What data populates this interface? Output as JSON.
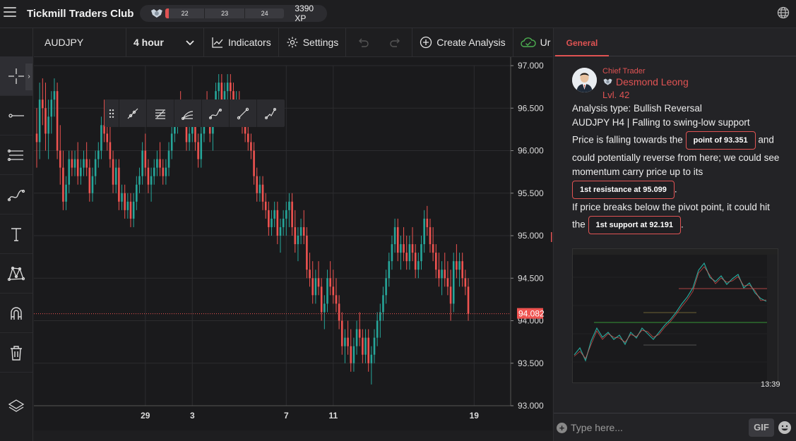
{
  "app": {
    "title": "Tickmill Traders Club"
  },
  "xp": {
    "levels": [
      "22",
      "23",
      "24"
    ],
    "progress_fraction": 0.03,
    "total": "3390 XP"
  },
  "toolbar": {
    "symbol": "AUDJPY",
    "interval": "4 hour",
    "indicators": "Indicators",
    "settings": "Settings",
    "create_analysis": "Create Analysis",
    "cut_label": "Ur"
  },
  "colors": {
    "up": "#26a69a",
    "down": "#ef5350",
    "accent": "#e05353",
    "bg": "#1a1a1c"
  },
  "chart_data": {
    "type": "candlestick",
    "symbol": "AUDJPY",
    "timeframe": "4 hour",
    "ylim": [
      93.0,
      97.0
    ],
    "y_ticks": [
      "97.000",
      "96.500",
      "96.000",
      "95.500",
      "95.000",
      "94.500",
      "94.000",
      "93.500",
      "93.000"
    ],
    "x_ticks": [
      {
        "label": "29",
        "index": 37
      },
      {
        "label": "3",
        "index": 53
      },
      {
        "label": "7",
        "index": 85
      },
      {
        "label": "11",
        "index": 101
      },
      {
        "label": "19",
        "index": 149
      }
    ],
    "last_price": "94.082",
    "ohlc": [
      [
        96.2,
        96.5,
        95.8,
        96.1
      ],
      [
        96.1,
        96.8,
        95.9,
        96.6
      ],
      [
        96.6,
        96.85,
        96.3,
        96.5
      ],
      [
        96.5,
        96.8,
        96.0,
        96.2
      ],
      [
        96.2,
        96.6,
        95.9,
        96.4
      ],
      [
        96.4,
        96.7,
        96.2,
        96.6
      ],
      [
        96.6,
        96.85,
        96.4,
        96.7
      ],
      [
        96.7,
        96.8,
        95.9,
        96.0
      ],
      [
        96.0,
        96.3,
        95.6,
        95.8
      ],
      [
        95.8,
        96.0,
        95.3,
        95.4
      ],
      [
        95.4,
        95.7,
        95.3,
        95.6
      ],
      [
        95.6,
        96.0,
        95.5,
        95.9
      ],
      [
        95.9,
        96.0,
        95.7,
        95.8
      ],
      [
        95.8,
        96.0,
        95.7,
        95.9
      ],
      [
        95.9,
        96.1,
        95.6,
        95.7
      ],
      [
        95.7,
        95.9,
        95.6,
        95.8
      ],
      [
        95.8,
        96.0,
        95.7,
        95.9
      ],
      [
        95.9,
        96.1,
        95.7,
        95.8
      ],
      [
        95.8,
        95.9,
        95.4,
        95.5
      ],
      [
        95.5,
        95.8,
        95.4,
        95.7
      ],
      [
        95.7,
        96.0,
        95.6,
        95.9
      ],
      [
        95.9,
        96.1,
        95.8,
        96.0
      ],
      [
        96.0,
        96.4,
        95.9,
        96.3
      ],
      [
        96.3,
        96.6,
        96.1,
        96.2
      ],
      [
        96.2,
        96.4,
        96.0,
        96.1
      ],
      [
        96.1,
        96.3,
        95.8,
        95.9
      ],
      [
        95.9,
        96.0,
        95.5,
        95.6
      ],
      [
        95.6,
        95.9,
        95.5,
        95.8
      ],
      [
        95.8,
        95.9,
        95.3,
        95.4
      ],
      [
        95.4,
        95.6,
        95.3,
        95.5
      ],
      [
        95.5,
        95.6,
        95.2,
        95.3
      ],
      [
        95.3,
        95.5,
        95.2,
        95.4
      ],
      [
        95.4,
        95.5,
        95.1,
        95.2
      ],
      [
        95.2,
        95.5,
        95.1,
        95.4
      ],
      [
        95.4,
        95.7,
        95.3,
        95.6
      ],
      [
        95.6,
        95.8,
        95.5,
        95.7
      ],
      [
        95.7,
        96.1,
        95.6,
        96.0
      ],
      [
        96.0,
        96.2,
        95.7,
        95.8
      ],
      [
        95.8,
        95.9,
        95.5,
        95.6
      ],
      [
        95.6,
        95.8,
        95.4,
        95.7
      ],
      [
        95.7,
        95.9,
        95.6,
        95.8
      ],
      [
        95.8,
        96.0,
        95.7,
        95.9
      ],
      [
        95.9,
        96.1,
        95.7,
        95.8
      ],
      [
        95.8,
        95.9,
        95.6,
        95.7
      ],
      [
        95.7,
        95.9,
        95.6,
        95.8
      ],
      [
        95.8,
        96.1,
        95.7,
        96.0
      ],
      [
        96.0,
        96.3,
        95.9,
        96.2
      ],
      [
        96.2,
        96.5,
        96.1,
        96.4
      ],
      [
        96.4,
        96.6,
        96.2,
        96.5
      ],
      [
        96.5,
        96.7,
        96.3,
        96.4
      ],
      [
        96.4,
        96.6,
        96.3,
        96.5
      ],
      [
        96.5,
        96.6,
        96.0,
        96.1
      ],
      [
        96.1,
        96.3,
        96.0,
        96.2
      ],
      [
        96.2,
        96.4,
        96.1,
        96.3
      ],
      [
        96.3,
        96.5,
        96.0,
        96.1
      ],
      [
        96.1,
        96.2,
        95.8,
        95.9
      ],
      [
        95.9,
        96.3,
        95.8,
        96.2
      ],
      [
        96.2,
        96.6,
        96.1,
        96.5
      ],
      [
        96.5,
        96.7,
        96.3,
        96.4
      ],
      [
        96.4,
        96.6,
        96.1,
        96.2
      ],
      [
        96.2,
        96.5,
        96.0,
        96.4
      ],
      [
        96.4,
        96.8,
        96.3,
        96.7
      ],
      [
        96.7,
        96.9,
        96.5,
        96.8
      ],
      [
        96.8,
        96.9,
        96.5,
        96.6
      ],
      [
        96.6,
        96.8,
        96.4,
        96.7
      ],
      [
        96.7,
        96.9,
        96.6,
        96.8
      ],
      [
        96.8,
        96.9,
        96.6,
        96.7
      ],
      [
        96.7,
        96.8,
        96.4,
        96.5
      ],
      [
        96.5,
        96.7,
        96.4,
        96.6
      ],
      [
        96.6,
        96.7,
        96.3,
        96.4
      ],
      [
        96.4,
        96.5,
        96.2,
        96.3
      ],
      [
        96.3,
        96.4,
        96.1,
        96.2
      ],
      [
        96.2,
        96.4,
        96.0,
        96.1
      ],
      [
        96.1,
        96.2,
        95.9,
        96.0
      ],
      [
        96.0,
        96.1,
        95.6,
        95.7
      ],
      [
        95.7,
        95.8,
        95.4,
        95.5
      ],
      [
        95.5,
        95.7,
        95.4,
        95.6
      ],
      [
        95.6,
        95.7,
        95.3,
        95.4
      ],
      [
        95.4,
        95.5,
        95.2,
        95.3
      ],
      [
        95.3,
        95.4,
        95.0,
        95.1
      ],
      [
        95.1,
        95.3,
        95.0,
        95.2
      ],
      [
        95.2,
        95.4,
        95.1,
        95.3
      ],
      [
        95.3,
        95.4,
        94.9,
        95.0
      ],
      [
        95.0,
        95.2,
        94.8,
        95.1
      ],
      [
        95.1,
        95.3,
        95.0,
        95.2
      ],
      [
        95.2,
        95.4,
        95.0,
        95.3
      ],
      [
        95.3,
        95.5,
        95.1,
        95.4
      ],
      [
        95.4,
        95.5,
        95.0,
        95.1
      ],
      [
        95.1,
        95.3,
        94.8,
        94.9
      ],
      [
        94.9,
        95.1,
        94.7,
        95.0
      ],
      [
        95.0,
        95.2,
        94.9,
        95.1
      ],
      [
        95.1,
        95.3,
        94.9,
        95.0
      ],
      [
        95.0,
        95.1,
        94.5,
        94.6
      ],
      [
        94.6,
        94.8,
        94.4,
        94.5
      ],
      [
        94.5,
        94.7,
        94.2,
        94.3
      ],
      [
        94.3,
        94.6,
        94.2,
        94.5
      ],
      [
        94.5,
        94.7,
        94.3,
        94.4
      ],
      [
        94.4,
        94.5,
        94.0,
        94.1
      ],
      [
        94.1,
        94.3,
        93.9,
        94.2
      ],
      [
        94.2,
        94.6,
        94.1,
        94.5
      ],
      [
        94.5,
        94.7,
        94.3,
        94.4
      ],
      [
        94.4,
        94.6,
        94.2,
        94.3
      ],
      [
        94.3,
        94.5,
        94.1,
        94.2
      ],
      [
        94.2,
        94.3,
        93.9,
        94.0
      ],
      [
        94.0,
        94.1,
        93.6,
        93.7
      ],
      [
        93.7,
        93.9,
        93.5,
        93.8
      ],
      [
        93.8,
        94.0,
        93.6,
        93.7
      ],
      [
        93.7,
        93.9,
        93.4,
        93.5
      ],
      [
        93.5,
        93.8,
        93.4,
        93.7
      ],
      [
        93.7,
        94.0,
        93.6,
        93.9
      ],
      [
        93.9,
        94.1,
        93.7,
        93.8
      ],
      [
        93.8,
        93.9,
        93.5,
        93.6
      ],
      [
        93.6,
        93.9,
        93.5,
        93.8
      ],
      [
        93.8,
        93.9,
        93.4,
        93.5
      ],
      [
        93.5,
        93.7,
        93.25,
        93.6
      ],
      [
        93.6,
        93.9,
        93.5,
        93.8
      ],
      [
        93.8,
        94.1,
        93.7,
        94.0
      ],
      [
        94.0,
        94.2,
        93.8,
        94.1
      ],
      [
        94.1,
        94.4,
        94.0,
        94.3
      ],
      [
        94.3,
        94.6,
        94.2,
        94.5
      ],
      [
        94.5,
        94.8,
        94.4,
        94.7
      ],
      [
        94.7,
        95.0,
        94.6,
        94.9
      ],
      [
        94.9,
        95.2,
        94.8,
        95.1
      ],
      [
        95.1,
        95.2,
        94.7,
        94.8
      ],
      [
        94.8,
        95.0,
        94.6,
        94.9
      ],
      [
        94.9,
        95.1,
        94.7,
        94.8
      ],
      [
        94.8,
        95.0,
        94.6,
        94.7
      ],
      [
        94.7,
        95.0,
        94.6,
        94.9
      ],
      [
        94.9,
        95.1,
        94.7,
        94.8
      ],
      [
        94.8,
        94.9,
        94.5,
        94.6
      ],
      [
        94.6,
        94.8,
        94.5,
        94.7
      ],
      [
        94.7,
        95.0,
        94.6,
        94.9
      ],
      [
        94.9,
        95.3,
        94.8,
        95.2
      ],
      [
        95.2,
        95.35,
        95.0,
        95.1
      ],
      [
        95.1,
        95.2,
        94.8,
        94.9
      ],
      [
        94.9,
        95.1,
        94.7,
        94.8
      ],
      [
        94.8,
        94.9,
        94.5,
        94.6
      ],
      [
        94.6,
        94.8,
        94.4,
        94.5
      ],
      [
        94.5,
        94.7,
        94.3,
        94.6
      ],
      [
        94.6,
        94.8,
        94.4,
        94.5
      ],
      [
        94.5,
        94.7,
        94.3,
        94.4
      ],
      [
        94.4,
        94.6,
        94.0,
        94.2
      ],
      [
        94.2,
        94.8,
        94.1,
        94.7
      ],
      [
        94.7,
        94.9,
        94.5,
        94.6
      ],
      [
        94.6,
        94.8,
        94.4,
        94.7
      ],
      [
        94.7,
        94.8,
        94.4,
        94.5
      ],
      [
        94.5,
        94.6,
        94.3,
        94.4
      ],
      [
        94.4,
        94.5,
        94.0,
        94.08
      ]
    ]
  },
  "panel": {
    "tab": "General",
    "author": {
      "role": "Chief Trader",
      "name": "Desmond Leong",
      "level": "Lvl. 42"
    },
    "message": {
      "line1": "Analysis type: Bullish Reversal",
      "line2": "AUDJPY H4 | Falling to swing-low support",
      "p1_pre": "Price is falling towards the",
      "pill1": "point of 93.351",
      "p1_post": "and could potentially reverse from here; we could see momentum carry price up to its",
      "pill2": "1st resistance at 95.099",
      "p2_pre": "If price breaks below the pivot point, it could hit the",
      "pill3": "1st support at 92.191"
    },
    "time": "13:39",
    "input_placeholder": "Type here...",
    "gif_label": "GIF"
  }
}
